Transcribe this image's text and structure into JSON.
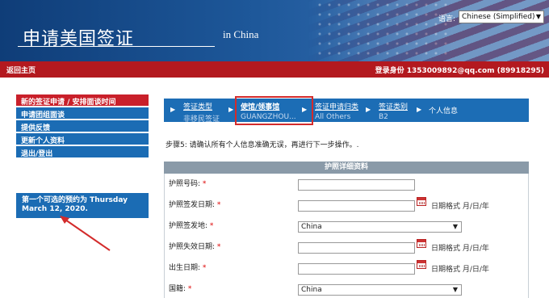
{
  "header": {
    "title": "申请美国签证",
    "subtitle": "in China",
    "language_label": "语言:",
    "language_value": "Chinese (Simplified)"
  },
  "topbar": {
    "home": "返回主页",
    "login_info": "登录身份 1353009892@qq.com (89918295)"
  },
  "sidebar": {
    "items": [
      {
        "label": "新的签证申请 / 安排面谈时间"
      },
      {
        "label": "申请团组面谈"
      },
      {
        "label": "提供反馈"
      },
      {
        "label": "更新个人资料"
      },
      {
        "label": "退出/登出"
      }
    ],
    "notice": "第一个可选的预约为 Thursday March 12, 2020."
  },
  "steps": [
    {
      "label": "签证类型",
      "value": "非移民签证"
    },
    {
      "label": "使馆/领事馆",
      "value": "GUANGZHOU..."
    },
    {
      "label": "签证申请归类",
      "value": "All Others"
    },
    {
      "label": "签证类别",
      "value": "B2"
    },
    {
      "label": "个人信息",
      "value": ""
    }
  ],
  "instruction": "步骤5: 请确认所有个人信息准确无误，再进行下一步操作。.",
  "passport": {
    "section_title": "护照详细资料",
    "required_mark": "*",
    "date_format": "日期格式 月/日/年",
    "fields": [
      {
        "label": "护照号码:",
        "value": ""
      },
      {
        "label": "护照签发日期:",
        "value": ""
      },
      {
        "label": "护照签发地:",
        "value": "China"
      },
      {
        "label": "护照失效日期:",
        "value": ""
      },
      {
        "label": "出生日期:",
        "value": ""
      },
      {
        "label": "国籍:",
        "value": "China"
      }
    ]
  },
  "colors": {
    "header_blue": "#1d5799",
    "nav_red": "#b3191f",
    "sidebar_blue": "#1b6cb4",
    "active_red": "#c9202a",
    "highlight_red": "#d32b2b"
  }
}
